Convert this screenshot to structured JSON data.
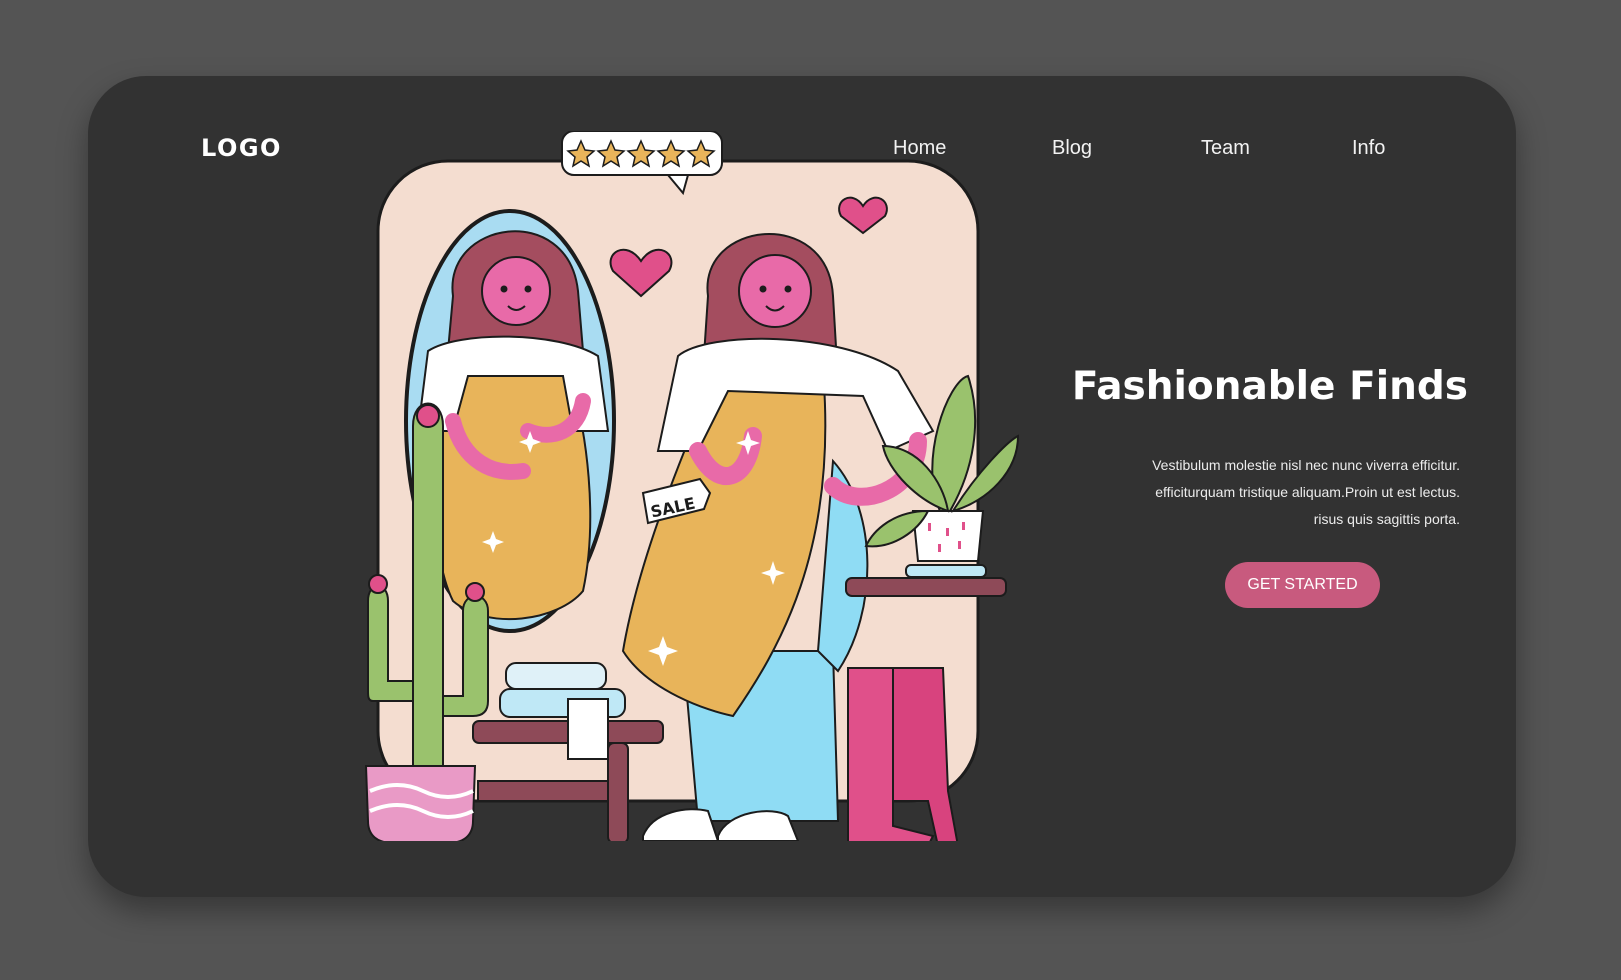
{
  "header": {
    "logo": "LOGO",
    "nav": [
      {
        "label": "Home"
      },
      {
        "label": "Blog"
      },
      {
        "label": "Team"
      },
      {
        "label": "Info"
      }
    ]
  },
  "hero": {
    "title": "Fashionable Finds",
    "lines": [
      "Vestibulum molestie nisl nec nunc viverra efficitur.",
      "efficiturquam tristique aliquam.Proin ut est lectus.",
      "risus quis sagittis porta."
    ],
    "cta_label": "GET STARTED"
  },
  "illustration": {
    "sale_tag": "SALE",
    "rating_stars": 5,
    "colors": {
      "accent_pink": "#c85a7e",
      "heart": "#e0508a",
      "dress": "#e8b45a",
      "mirror": "#a9dcf2",
      "backdrop": "#f4ddd0"
    }
  }
}
